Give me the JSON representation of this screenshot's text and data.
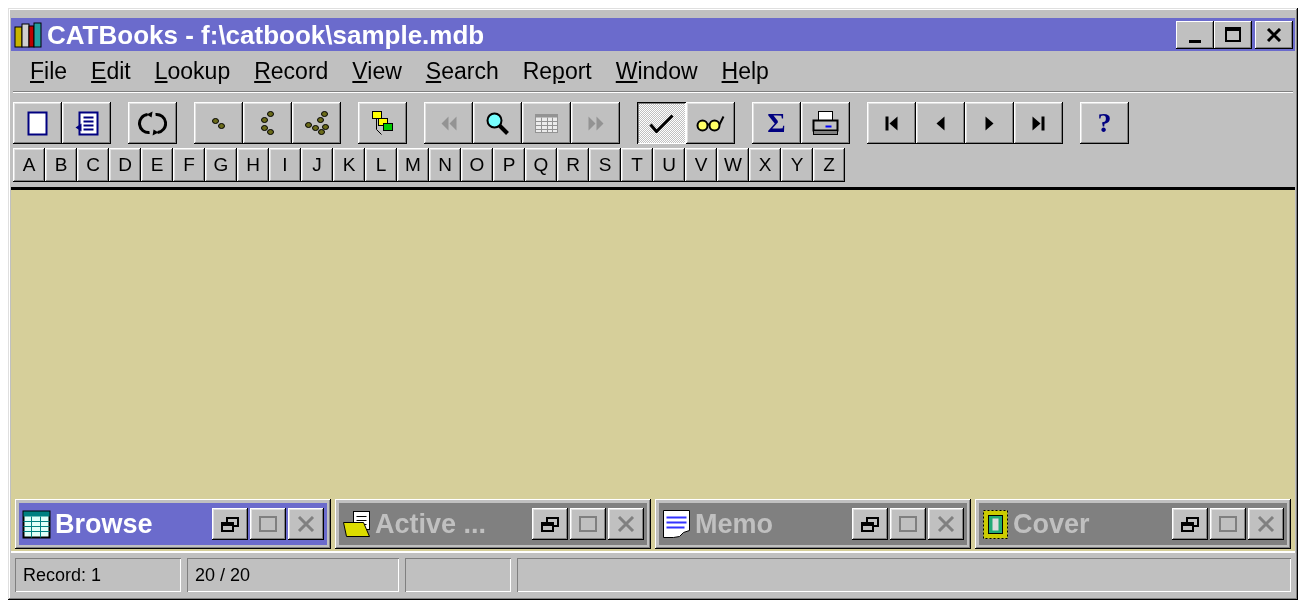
{
  "window": {
    "title": "CATBooks - f:\\catbook\\sample.mdb"
  },
  "menu": [
    {
      "key": "F",
      "post": "ile"
    },
    {
      "key": "E",
      "post": "dit"
    },
    {
      "key": "L",
      "post": "ookup"
    },
    {
      "key": "R",
      "post": "ecord"
    },
    {
      "key": "V",
      "post": "iew"
    },
    {
      "key": "S",
      "post": "earch"
    },
    {
      "pre": "Re",
      "key": "p",
      "post": "ort"
    },
    {
      "key": "W",
      "post": "indow"
    },
    {
      "key": "H",
      "post": "elp"
    }
  ],
  "toolbar": [
    [
      {
        "kind": "page",
        "disabled": false,
        "pressed": false
      },
      {
        "kind": "form",
        "disabled": false,
        "pressed": false
      }
    ],
    [
      {
        "kind": "refresh",
        "disabled": false,
        "pressed": false
      }
    ],
    [
      {
        "kind": "one-dot",
        "disabled": false,
        "pressed": false
      },
      {
        "kind": "two-dots",
        "disabled": false,
        "pressed": false
      },
      {
        "kind": "three-dots",
        "disabled": false,
        "pressed": false
      }
    ],
    [
      {
        "kind": "tree",
        "disabled": false,
        "pressed": false
      }
    ],
    [
      {
        "kind": "rewind",
        "disabled": true,
        "pressed": false
      },
      {
        "kind": "search",
        "disabled": false,
        "pressed": false
      },
      {
        "kind": "grid",
        "disabled": true,
        "pressed": false
      },
      {
        "kind": "fast-forward",
        "disabled": true,
        "pressed": false
      }
    ],
    [
      {
        "kind": "check",
        "disabled": false,
        "pressed": true
      },
      {
        "kind": "glasses",
        "disabled": false,
        "pressed": false
      }
    ],
    [
      {
        "kind": "glyph",
        "glyph": "Σ",
        "disabled": false,
        "pressed": false
      },
      {
        "kind": "printer",
        "disabled": false,
        "pressed": false
      }
    ],
    [
      {
        "kind": "first",
        "disabled": false,
        "pressed": false
      },
      {
        "kind": "previous",
        "disabled": false,
        "pressed": false
      },
      {
        "kind": "next",
        "disabled": false,
        "pressed": false
      },
      {
        "kind": "last",
        "disabled": false,
        "pressed": false
      }
    ],
    [
      {
        "kind": "glyph",
        "glyph": "?",
        "disabled": false,
        "pressed": false
      }
    ]
  ],
  "letters": [
    "A",
    "B",
    "C",
    "D",
    "E",
    "F",
    "G",
    "H",
    "I",
    "J",
    "K",
    "L",
    "M",
    "N",
    "O",
    "P",
    "Q",
    "R",
    "S",
    "T",
    "U",
    "V",
    "W",
    "X",
    "Y",
    "Z"
  ],
  "minimized_windows": [
    {
      "title": "Browse",
      "kind": "table",
      "selected": true
    },
    {
      "title": "Active ...",
      "kind": "folder",
      "selected": false
    },
    {
      "title": "Memo",
      "kind": "note",
      "selected": false
    },
    {
      "title": "Cover",
      "kind": "frame",
      "selected": false
    }
  ],
  "status_bar": [
    "Record: 1",
    "20 / 20"
  ]
}
